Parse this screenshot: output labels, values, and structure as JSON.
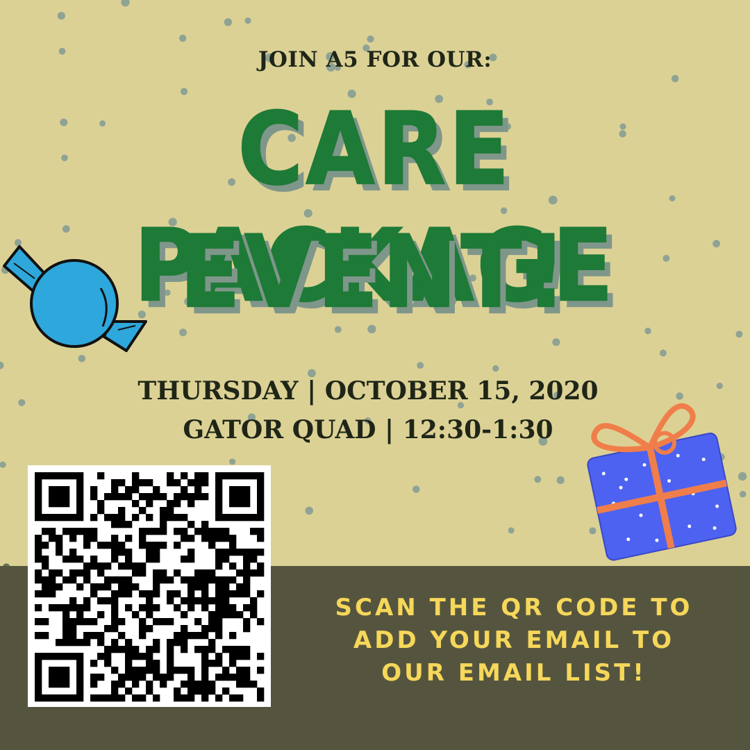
{
  "intro": "JOIN A5 FOR OUR:",
  "headline": {
    "line1": "CARE PACKAGE",
    "line2": "EVENT!"
  },
  "details": {
    "line1": "THURSDAY | OCTOBER 15, 2020",
    "line2": "GATOR QUAD | 12:30-1:30"
  },
  "call_to_action": {
    "line1": "SCAN THE QR CODE  TO",
    "line2": "ADD YOUR EMAIL TO",
    "line3": "OUR EMAIL LIST!"
  },
  "colors": {
    "background": "#dcd195",
    "band": "#55553f",
    "headline": "#1e7a37",
    "cta": "#f6d75a",
    "dots": "#8a9f8e"
  },
  "icons": [
    "candy-icon",
    "gift-box-icon",
    "qr-code"
  ]
}
